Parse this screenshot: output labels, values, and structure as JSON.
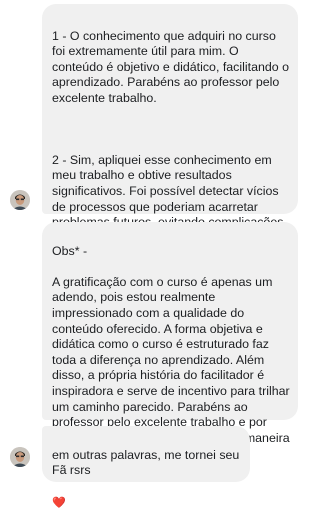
{
  "conversation": {
    "message1": {
      "paragraph1": "1 - O conhecimento que adquiri no curso foi extremamente útil para mim. O conteúdo é objetivo e didático, facilitando o aprendizado. Parabéns ao professor pelo excelente trabalho.",
      "paragraph2": "2 - Sim, apliquei esse conhecimento em meu trabalho e obtive resultados significativos. Foi possível detectar vícios de processos que poderiam acarretar problemas futuros, evitando complicações e melhorando a eficiência."
    },
    "message2": {
      "heading": "Obs* -",
      "body": "A gratificação com o curso é apenas um adendo, pois estou realmente impressionado com a qualidade do conteúdo oferecido. A forma objetiva e didática como o curso é estruturado faz toda a diferença no aprendizado. Além disso, a própria história do facilitador é inspiradora e serve de incentivo para trilhar um caminho parecido. Parabéns ao professor pelo excelente trabalho e por compartilhar seu conhecimento de maneira tão eficaz."
    },
    "message3": {
      "text": "em outras palavras, me tornei seu Fã rsrs",
      "reaction": "❤️"
    }
  },
  "colors": {
    "bubble_background": "#f0f0f0",
    "text": "#1c1e21",
    "reaction": "#e0245e"
  },
  "icons": {
    "avatar": "user-avatar"
  }
}
